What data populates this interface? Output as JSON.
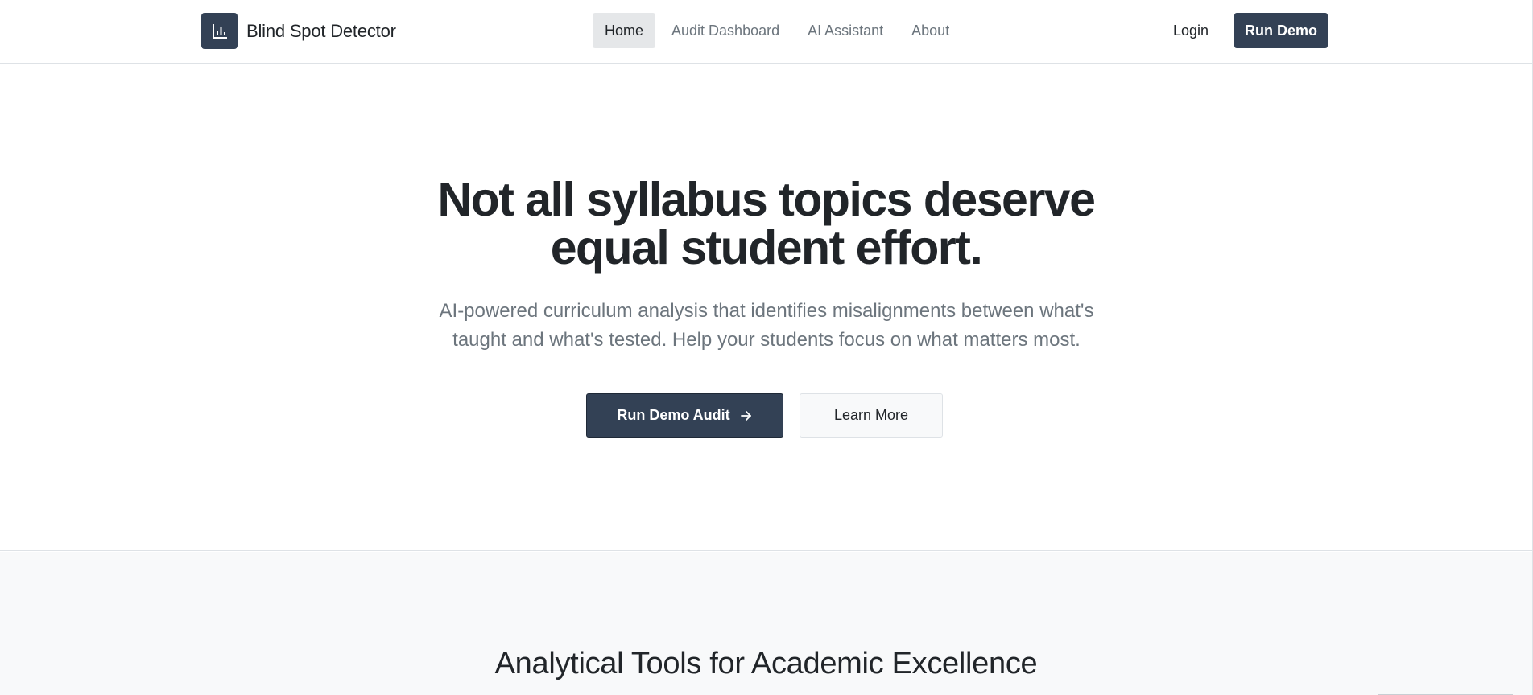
{
  "header": {
    "brand": "Blind Spot Detector",
    "nav": [
      "Home",
      "Audit Dashboard",
      "AI Assistant",
      "About"
    ],
    "active_nav": "Home",
    "login": "Login",
    "run_demo": "Run Demo"
  },
  "hero": {
    "title_line1": "Not all syllabus topics deserve",
    "title_line2": "equal student effort.",
    "subtitle_line1": "AI-powered curriculum analysis that identifies misalignments between what's",
    "subtitle_line2": "taught and what's tested. Help your students focus on what matters most.",
    "primary_cta": "Run Demo Audit",
    "secondary_cta": "Learn More"
  },
  "tools": {
    "title": "Analytical Tools for Academic Excellence"
  },
  "icons": {
    "logo": "bar-chart-icon",
    "cta_arrow": "arrow-right-icon"
  },
  "colors": {
    "primary": "#334155",
    "muted_text": "#6c757d",
    "heading_text": "#212529",
    "nav_active_bg": "#e5e7e9",
    "section_bg": "#f8f9fa"
  }
}
